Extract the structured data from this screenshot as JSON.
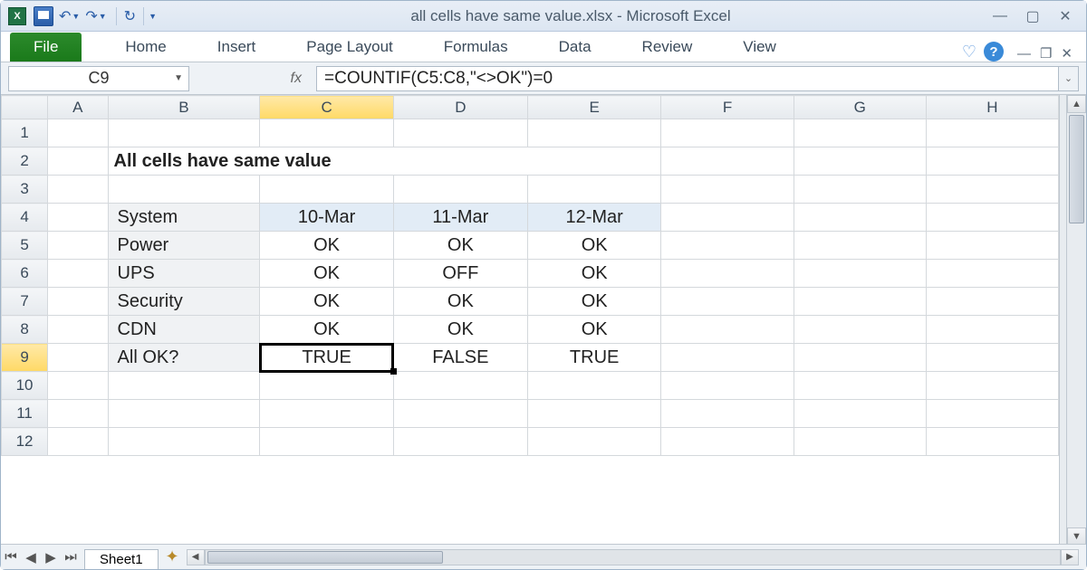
{
  "title": "all cells have same value.xlsx  -  Microsoft Excel",
  "qa": {
    "excel_letter": "X"
  },
  "ribbon": {
    "file": "File",
    "tabs": [
      "Home",
      "Insert",
      "Page Layout",
      "Formulas",
      "Data",
      "Review",
      "View"
    ]
  },
  "namebox": "C9",
  "formula": "=COUNTIF(C5:C8,\"<>OK\")=0",
  "columns": [
    "A",
    "B",
    "C",
    "D",
    "E",
    "F",
    "G",
    "H"
  ],
  "rows": [
    "1",
    "2",
    "3",
    "4",
    "5",
    "6",
    "7",
    "8",
    "9",
    "10",
    "11",
    "12"
  ],
  "heading": "All cells have same value",
  "table": {
    "headers": [
      "System",
      "10-Mar",
      "11-Mar",
      "12-Mar"
    ],
    "rows": [
      [
        "Power",
        "OK",
        "OK",
        "OK"
      ],
      [
        "UPS",
        "OK",
        "OFF",
        "OK"
      ],
      [
        "Security",
        "OK",
        "OK",
        "OK"
      ],
      [
        "CDN",
        "OK",
        "OK",
        "OK"
      ],
      [
        "All OK?",
        "TRUE",
        "FALSE",
        "TRUE"
      ]
    ]
  },
  "sheet_tab": "Sheet1",
  "active": {
    "col": "C",
    "row": "9"
  }
}
